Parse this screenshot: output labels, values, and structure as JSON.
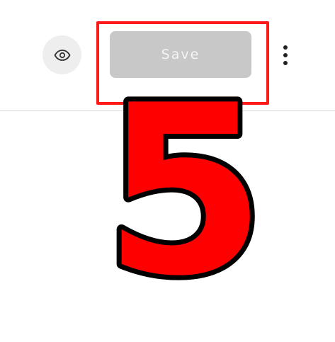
{
  "toolbar": {
    "preview_icon": "eye-icon",
    "save_label": "Save",
    "more_icon": "more-vertical-icon"
  },
  "annotation": {
    "highlight_color": "#ff1a1a",
    "step_number": "5",
    "step_fill": "#ff0000",
    "step_outline": "#000000"
  },
  "colors": {
    "save_button_bg": "#c8c8c8",
    "save_button_text": "#f4f4f4",
    "preview_button_bg": "#eeeeee"
  }
}
